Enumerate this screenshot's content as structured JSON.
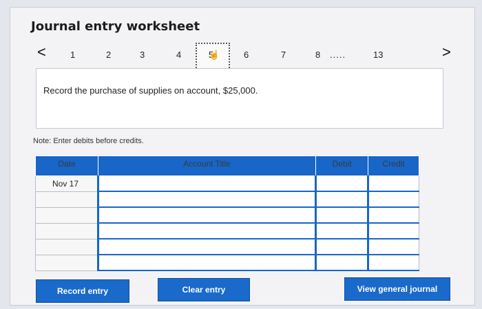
{
  "header": {
    "title": "Journal entry worksheet"
  },
  "pager": {
    "prev": "<",
    "next": ">",
    "pages": [
      "1",
      "2",
      "3",
      "4",
      "5",
      "6",
      "7",
      "8",
      ".....",
      "13"
    ],
    "current": "5"
  },
  "prompt": {
    "text": "Record the purchase of supplies on account, $25,000."
  },
  "note": "Note: Enter debits before credits.",
  "table": {
    "headers": {
      "date": "Date",
      "account": "Account Title",
      "debit": "Debit",
      "credit": "Credit"
    },
    "rows": [
      {
        "date": "Nov 17",
        "account": "",
        "debit": "",
        "credit": ""
      },
      {
        "date": "",
        "account": "",
        "debit": "",
        "credit": ""
      },
      {
        "date": "",
        "account": "",
        "debit": "",
        "credit": ""
      },
      {
        "date": "",
        "account": "",
        "debit": "",
        "credit": ""
      },
      {
        "date": "",
        "account": "",
        "debit": "",
        "credit": ""
      },
      {
        "date": "",
        "account": "",
        "debit": "",
        "credit": ""
      }
    ]
  },
  "buttons": {
    "record": "Record entry",
    "clear": "Clear entry",
    "view": "View general journal"
  },
  "colors": {
    "accent": "#1766c8"
  }
}
